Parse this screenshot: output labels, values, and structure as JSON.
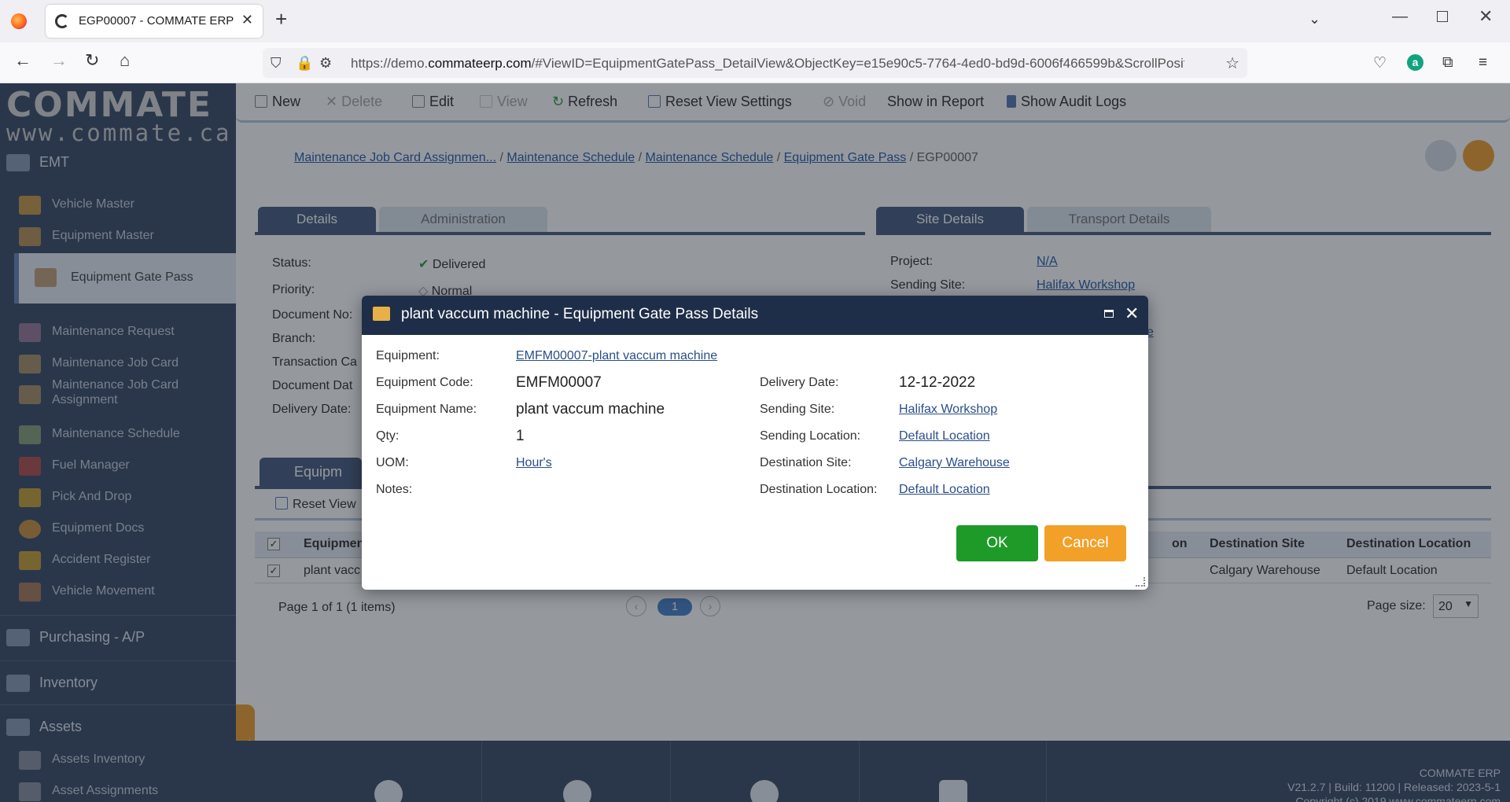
{
  "browser": {
    "tab_title": "EGP00007 - COMMATE ERP",
    "url_prefix": "https://demo.",
    "url_domain": "commateerp.com",
    "url_rest": "/#ViewID=EquipmentGatePass_DetailView&ObjectKey=e15e90c5-7764-4ed0-bd9d-6006f466599b&ScrollPosition"
  },
  "logo": {
    "main": "COMMATE",
    "sub": "www.commate.ca"
  },
  "sidebar": {
    "section_emt": "EMT",
    "items": [
      {
        "label": "Vehicle Master"
      },
      {
        "label": "Equipment Master"
      },
      {
        "label": "Equipment Gate Pass"
      },
      {
        "label": "Maintenance Request"
      },
      {
        "label": "Maintenance Job Card"
      },
      {
        "label": "Maintenance Job Card Assignment"
      },
      {
        "label": "Maintenance Schedule"
      },
      {
        "label": "Fuel Manager"
      },
      {
        "label": "Pick And Drop"
      },
      {
        "label": "Equipment Docs"
      },
      {
        "label": "Accident Register"
      },
      {
        "label": "Vehicle Movement"
      }
    ],
    "section_purchasing": "Purchasing - A/P",
    "section_inventory": "Inventory",
    "section_assets": "Assets",
    "assets_items": [
      {
        "label": "Assets Inventory"
      },
      {
        "label": "Asset Assignments"
      }
    ]
  },
  "toolbar": {
    "new": "New",
    "delete": "Delete",
    "edit": "Edit",
    "view": "View",
    "refresh": "Refresh",
    "reset": "Reset View Settings",
    "void": "Void",
    "report": "Show in Report",
    "audit": "Show Audit Logs"
  },
  "breadcrumb": {
    "c1": "Maintenance Job Card Assignmen...",
    "c2": "Maintenance Schedule",
    "c3": "Maintenance Schedule",
    "c4": "Equipment Gate Pass",
    "current": "EGP00007",
    "sep": " / "
  },
  "detail_tabs": {
    "details": "Details",
    "administration": "Administration"
  },
  "site_tabs": {
    "site": "Site Details",
    "transport": "Transport Details"
  },
  "details": {
    "status_label": "Status:",
    "status_value": "Delivered",
    "priority_label": "Priority:",
    "priority_value": "Normal",
    "docno_label": "Document No:",
    "branch_label": "Branch:",
    "trans_label": "Transaction Ca",
    "docdate_label": "Document Dat",
    "deldate_label": "Delivery Date:"
  },
  "site": {
    "project_label": "Project:",
    "project_value": "N/A",
    "sending_label": "Sending Site:",
    "sending_value": "Halifax Workshop",
    "partial_link": "e"
  },
  "grid": {
    "tab_label": "Equipm",
    "reset": "Reset View",
    "headers": [
      "Equipmen",
      "on",
      "Destination Site",
      "Destination Location"
    ],
    "row": [
      "plant vacc",
      "Calgary Warehouse",
      "Default Location"
    ],
    "pager": "Page 1 of 1 (1 items)",
    "page": "1",
    "page_size_label": "Page size:",
    "page_size": "20"
  },
  "footer": {
    "line1": "COMMATE ERP",
    "line2": "V21.2.7 | Build: 11200 | Released: 2023-5-1",
    "line3": "Copyright (c) 2019 www.commateerp.com"
  },
  "dialog": {
    "title": "plant vaccum machine - Equipment Gate Pass Details",
    "equipment_label": "Equipment:",
    "equipment_value": "EMFM00007-plant vaccum machine",
    "code_label": "Equipment Code:",
    "code_value": "EMFM00007",
    "name_label": "Equipment Name:",
    "name_value": "plant vaccum machine",
    "qty_label": "Qty:",
    "qty_value": "1",
    "uom_label": "UOM:",
    "uom_value": "Hour's",
    "notes_label": "Notes:",
    "deldate_label": "Delivery Date:",
    "deldate_value": "12-12-2022",
    "sending_site_label": "Sending Site:",
    "sending_site_value": "Halifax Workshop",
    "sending_loc_label": "Sending Location:",
    "sending_loc_value": "Default Location",
    "dest_site_label": "Destination Site:",
    "dest_site_value": "Calgary Warehouse",
    "dest_loc_label": "Destination Location:",
    "dest_loc_value": "Default Location",
    "ok": "OK",
    "cancel": "Cancel"
  },
  "colors": {
    "header": "#1f2e48",
    "ok": "#1e9a28",
    "cancel": "#f2a028",
    "sidebar": "#3d4e68"
  }
}
